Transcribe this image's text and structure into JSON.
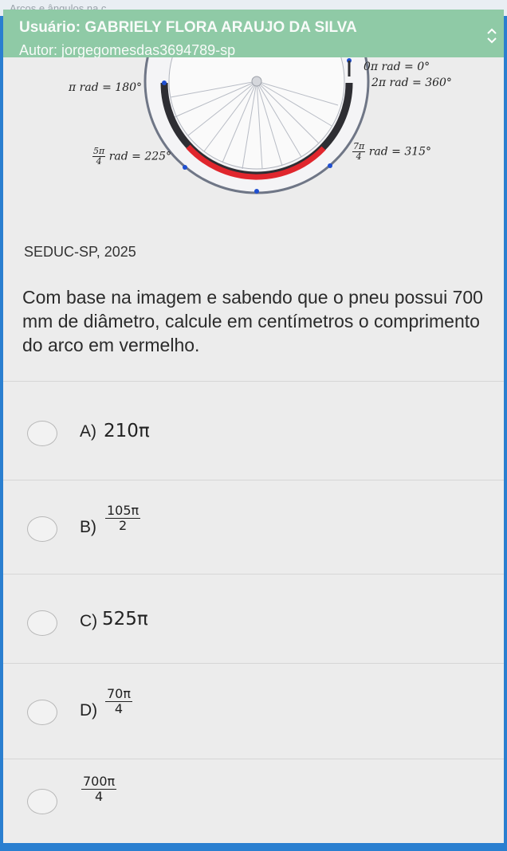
{
  "top_bar": {
    "title": "Arcos e ângulos na c"
  },
  "header": {
    "user": "Usuário: GABRIELY FLORA ARAUJO DA SILVA",
    "author": "Autor: jorgegomesdas3694789-sp"
  },
  "figure": {
    "label_0": "0π rad = 0°",
    "label_2pi": "2π rad = 360°",
    "label_pi": "π rad = 180°",
    "label_5pi4_num": "5π",
    "label_5pi4_den": "4",
    "label_5pi4_rest": "rad = 225°",
    "label_7pi4_num": "7π",
    "label_7pi4_den": "4",
    "label_7pi4_rest": "rad = 315°",
    "colors": {
      "arc_red": "#e0262d",
      "arc_dark": "#2e2e33",
      "tire_fill": "#f4f4f6"
    }
  },
  "source": "SEDUC-SP, 2025",
  "question": "Com base na imagem e sabendo que o pneu possui 700 mm de diâmetro, calcule em centímetros o comprimento do arco em vermelho.",
  "options": [
    {
      "letter": "A)",
      "value": "210π"
    },
    {
      "letter": "B)",
      "num": "105π",
      "den": "2"
    },
    {
      "letter": "C)",
      "value": "525π"
    },
    {
      "letter": "D)",
      "num": "70π",
      "den": "4"
    },
    {
      "letter": "",
      "num": "700π",
      "den": "4"
    }
  ]
}
